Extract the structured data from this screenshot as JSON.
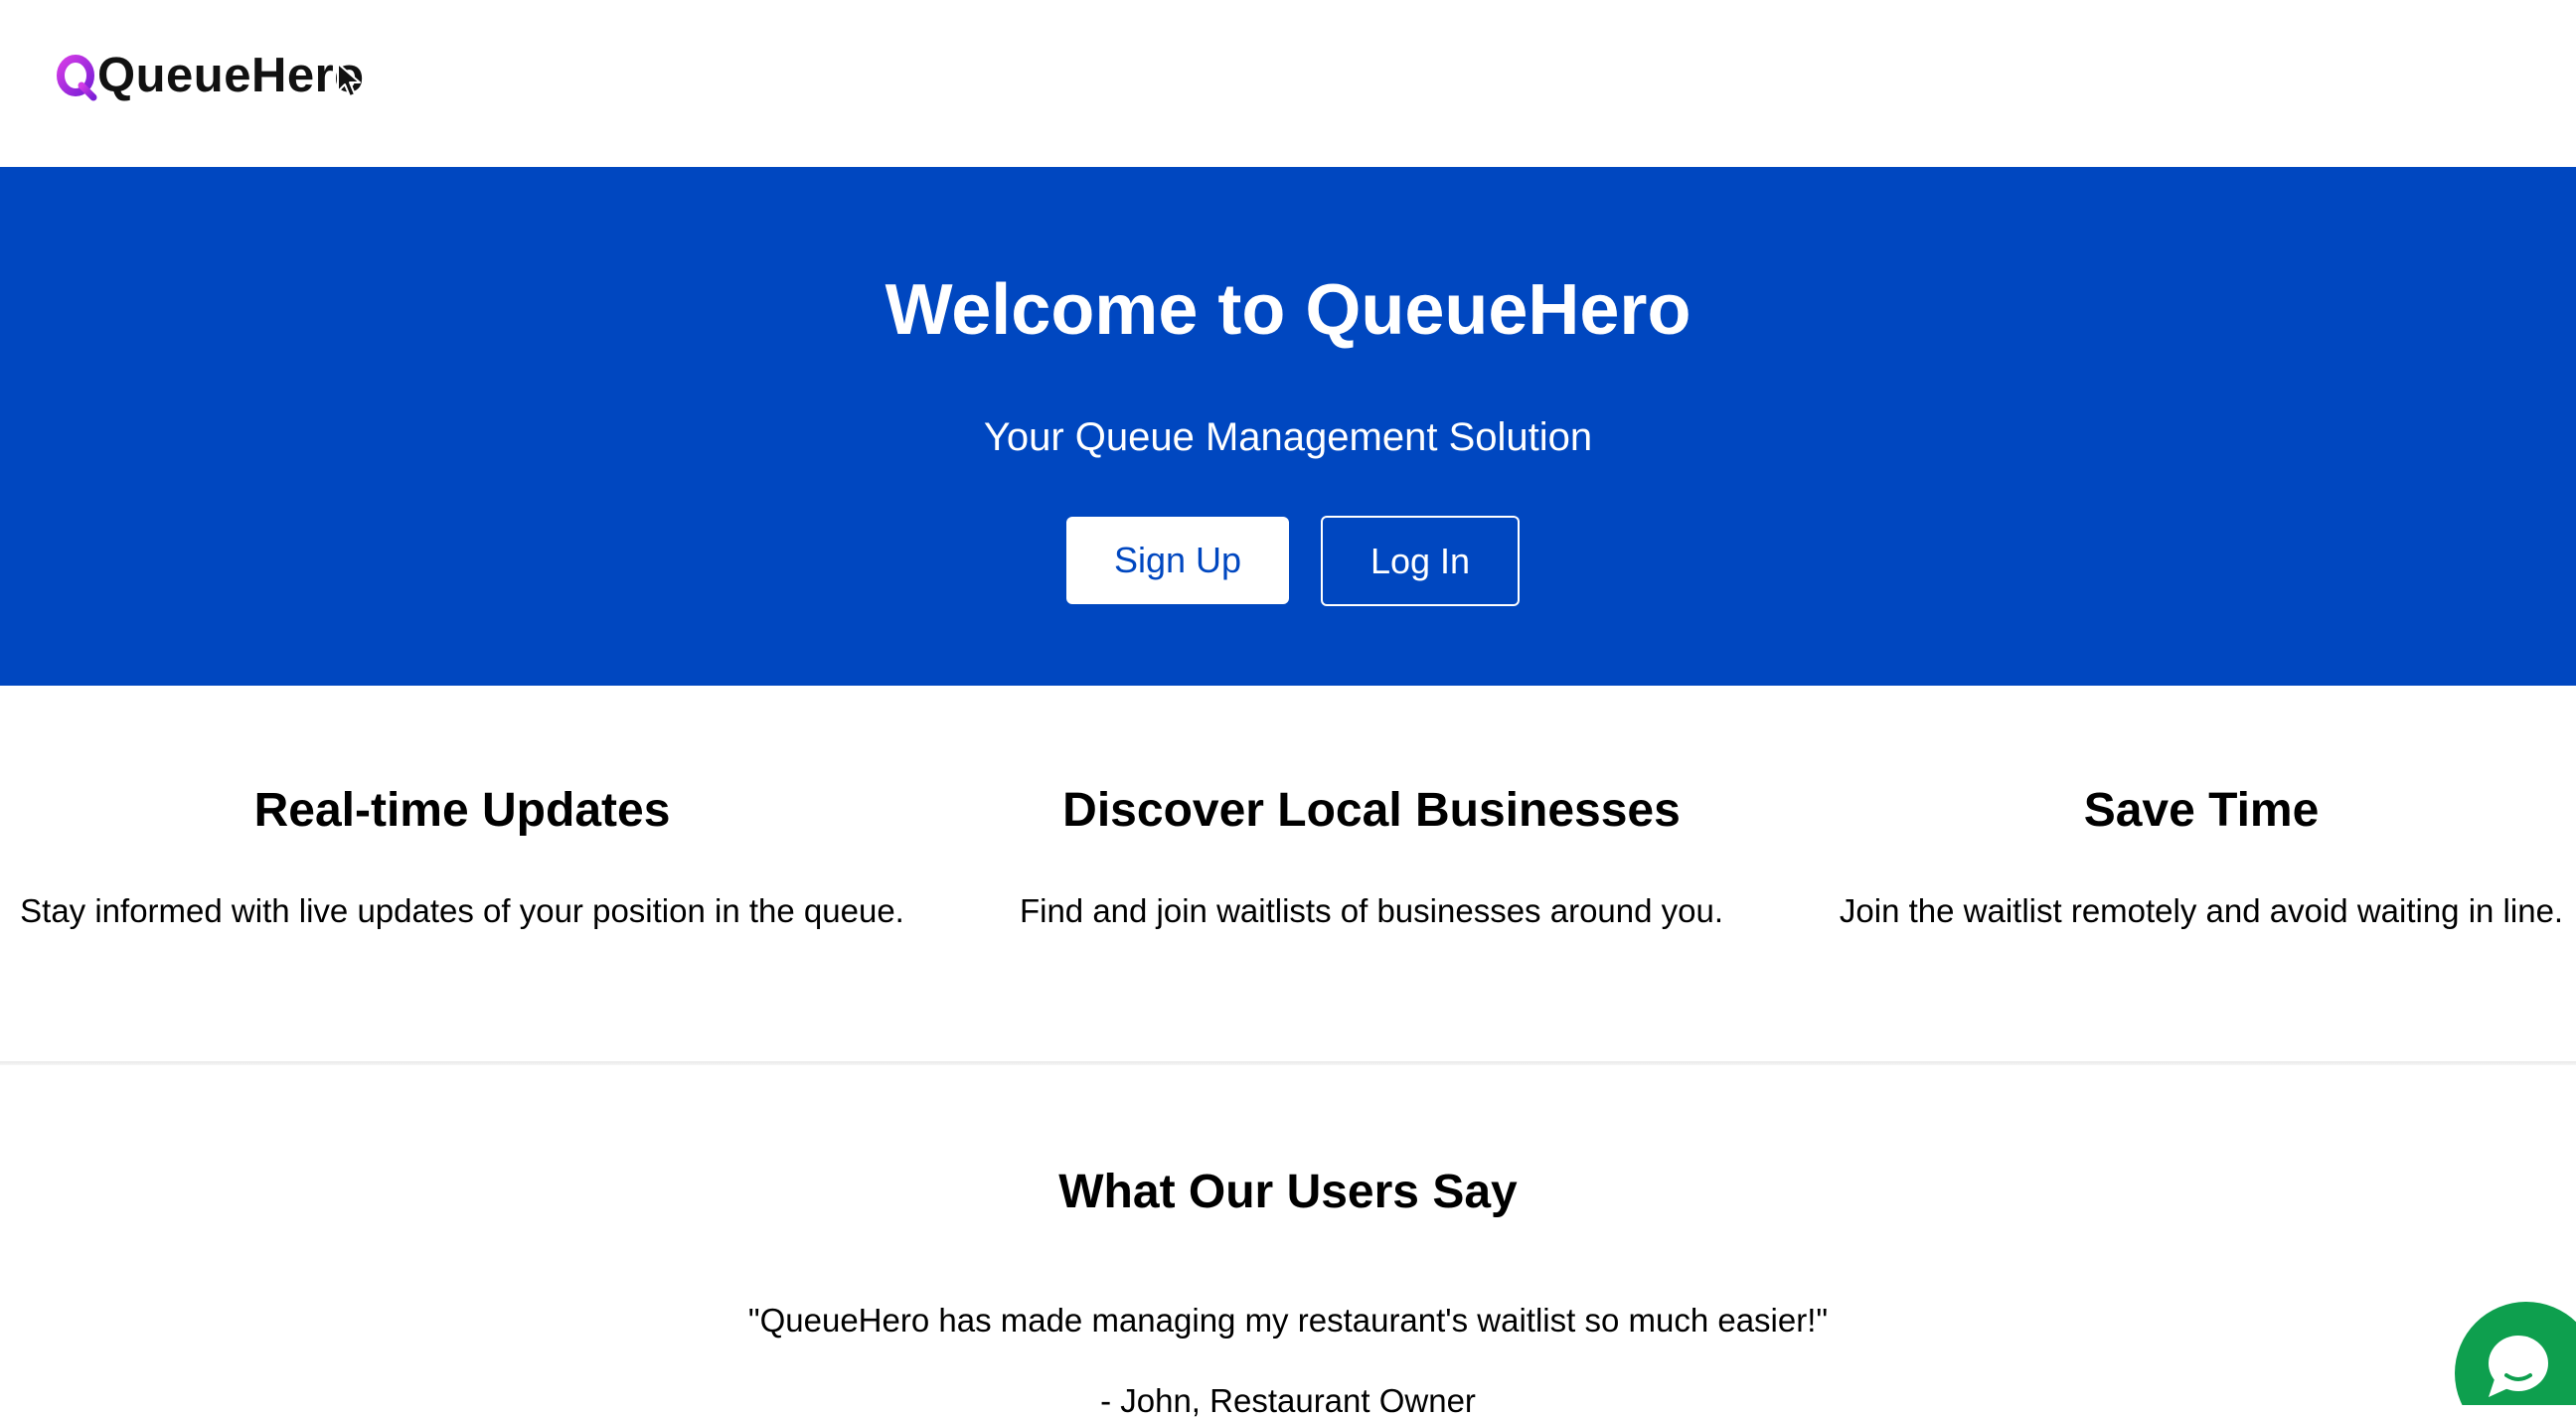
{
  "header": {
    "logo_text": "QueueHero",
    "logo_initial": "Q"
  },
  "hero": {
    "title": "Welcome to QueueHero",
    "subtitle": "Your Queue Management Solution",
    "signup_label": "Sign Up",
    "login_label": "Log In"
  },
  "features": [
    {
      "title": "Real-time Updates",
      "description": "Stay informed with live updates of your position in the queue."
    },
    {
      "title": "Discover Local Businesses",
      "description": "Find and join waitlists of businesses around you."
    },
    {
      "title": "Save Time",
      "description": "Join the waitlist remotely and avoid waiting in line."
    }
  ],
  "testimonials": {
    "title": "What Our Users Say",
    "quote": "\"QueueHero has made managing my restaurant's waitlist so much easier!\"",
    "author": "- John, Restaurant Owner"
  },
  "colors": {
    "brand_blue": "#0047c0",
    "logo_gradient_start": "#c42bd9",
    "logo_gradient_end": "#7a1fd6",
    "chat_green": "#0e9f4e"
  },
  "icons": {
    "logo": "queuehero-logo-icon",
    "cursor": "mouse-pointer-icon",
    "chat": "chat-bubble-icon"
  }
}
